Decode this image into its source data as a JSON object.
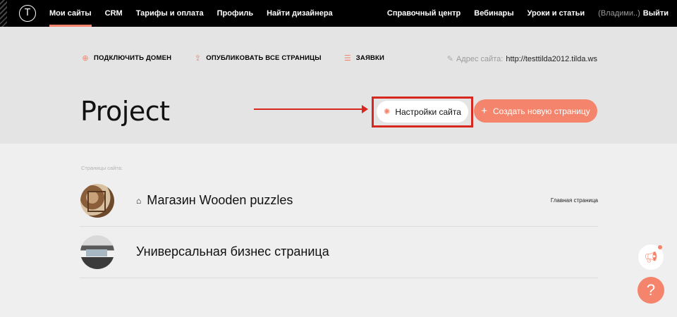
{
  "nav": {
    "logo": "T",
    "left": [
      "Мои сайты",
      "CRM",
      "Тарифы и оплата",
      "Профиль",
      "Найти дизайнера"
    ],
    "right": [
      "Справочный центр",
      "Вебинары",
      "Уроки и статьи"
    ],
    "user": "(Владими..)",
    "logout": "Выйти"
  },
  "actions": {
    "connect_domain": "ПОДКЛЮЧИТЬ ДОМЕН",
    "publish_all": "ОПУБЛИКОВАТЬ ВСЕ СТРАНИЦЫ",
    "requests": "ЗАЯВКИ"
  },
  "site_address": {
    "label": "Адрес сайта:",
    "url": "http://testtilda2012.tilda.ws"
  },
  "project": {
    "title": "Project",
    "settings_button": "Настройки сайта",
    "create_button": "Создать новую страницу"
  },
  "pages": {
    "label": "Страницы сайта:",
    "items": [
      {
        "title": "Магазин Wooden puzzles",
        "tag": "Главная страница"
      },
      {
        "title": "Универсальная бизнес страница",
        "tag": ""
      }
    ]
  },
  "colors": {
    "accent": "#f4846b",
    "highlight": "#d6281f"
  },
  "icons": {
    "help": "?"
  }
}
